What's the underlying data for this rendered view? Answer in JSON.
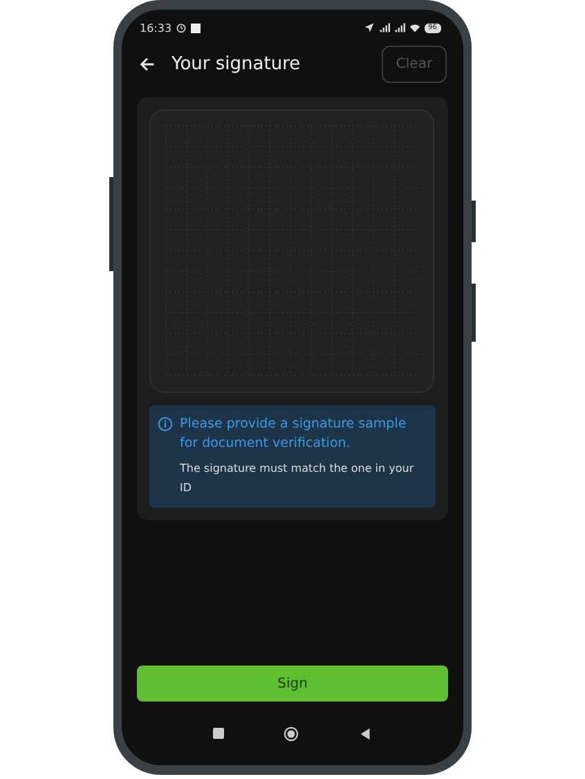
{
  "status_bar": {
    "time": "16:33",
    "battery": "96"
  },
  "header": {
    "title": "Your signature",
    "clear_button": {
      "label": "Clear",
      "disabled": true
    }
  },
  "notice": {
    "title": "Please provide a signature sample for document verification.",
    "body": "The signature must match the one in your ID"
  },
  "sign_button": {
    "label": "Sign"
  }
}
